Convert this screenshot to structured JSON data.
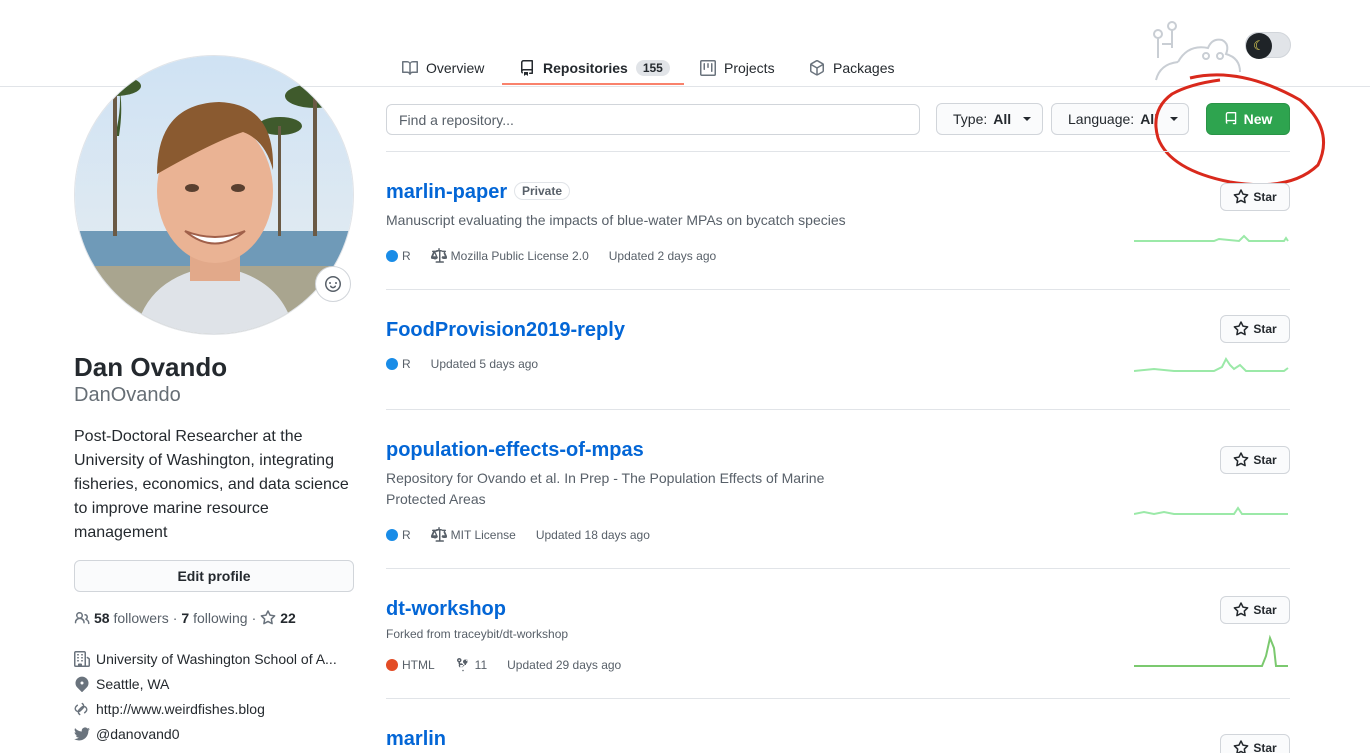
{
  "tabs": [
    {
      "label": "Overview"
    },
    {
      "label": "Repositories",
      "count": "155"
    },
    {
      "label": "Projects"
    },
    {
      "label": "Packages"
    }
  ],
  "profile": {
    "full_name": "Dan Ovando",
    "username": "DanOvando",
    "bio": "Post-Doctoral Researcher at the University of Washington, integrating fisheries, economics, and data science to improve marine resource management",
    "edit_label": "Edit profile",
    "followers_count": "58",
    "followers_label": "followers",
    "following_count": "7",
    "following_label": "following",
    "stars_count": "22",
    "organization": "University of Washington School of A...",
    "location": "Seattle, WA",
    "website": "http://www.weirdfishes.blog",
    "twitter": "@danovand0"
  },
  "filters": {
    "search_placeholder": "Find a repository...",
    "type_label": "Type:",
    "type_value": "All",
    "language_label": "Language:",
    "language_value": "All",
    "new_label": "New"
  },
  "repos": [
    {
      "name": "marlin-paper",
      "badge": "Private",
      "description": "Manuscript evaluating the impacts of blue-water MPAs on bycatch species",
      "language": "R",
      "language_color": "#198ce7",
      "license": "Mozilla Public License 2.0",
      "updated": "Updated 2 days ago",
      "star_label": "Star"
    },
    {
      "name": "FoodProvision2019-reply",
      "language": "R",
      "language_color": "#198ce7",
      "updated": "Updated 5 days ago",
      "star_label": "Star"
    },
    {
      "name": "population-effects-of-mpas",
      "description": "Repository for Ovando et al. In Prep - The Population Effects of Marine Protected Areas",
      "language": "R",
      "language_color": "#198ce7",
      "license": "MIT License",
      "updated": "Updated 18 days ago",
      "star_label": "Star"
    },
    {
      "name": "dt-workshop",
      "forked_from": "Forked from traceybit/dt-workshop",
      "language": "HTML",
      "language_color": "#e34c26",
      "forks": "11",
      "updated": "Updated 29 days ago",
      "star_label": "Star"
    },
    {
      "name": "marlin",
      "star_label": "Star"
    }
  ],
  "colors": {
    "accent_link": "#0366d6",
    "new_button": "#2ea44f",
    "tab_underline": "#f9826c",
    "annotation_circle": "#d9291c"
  }
}
